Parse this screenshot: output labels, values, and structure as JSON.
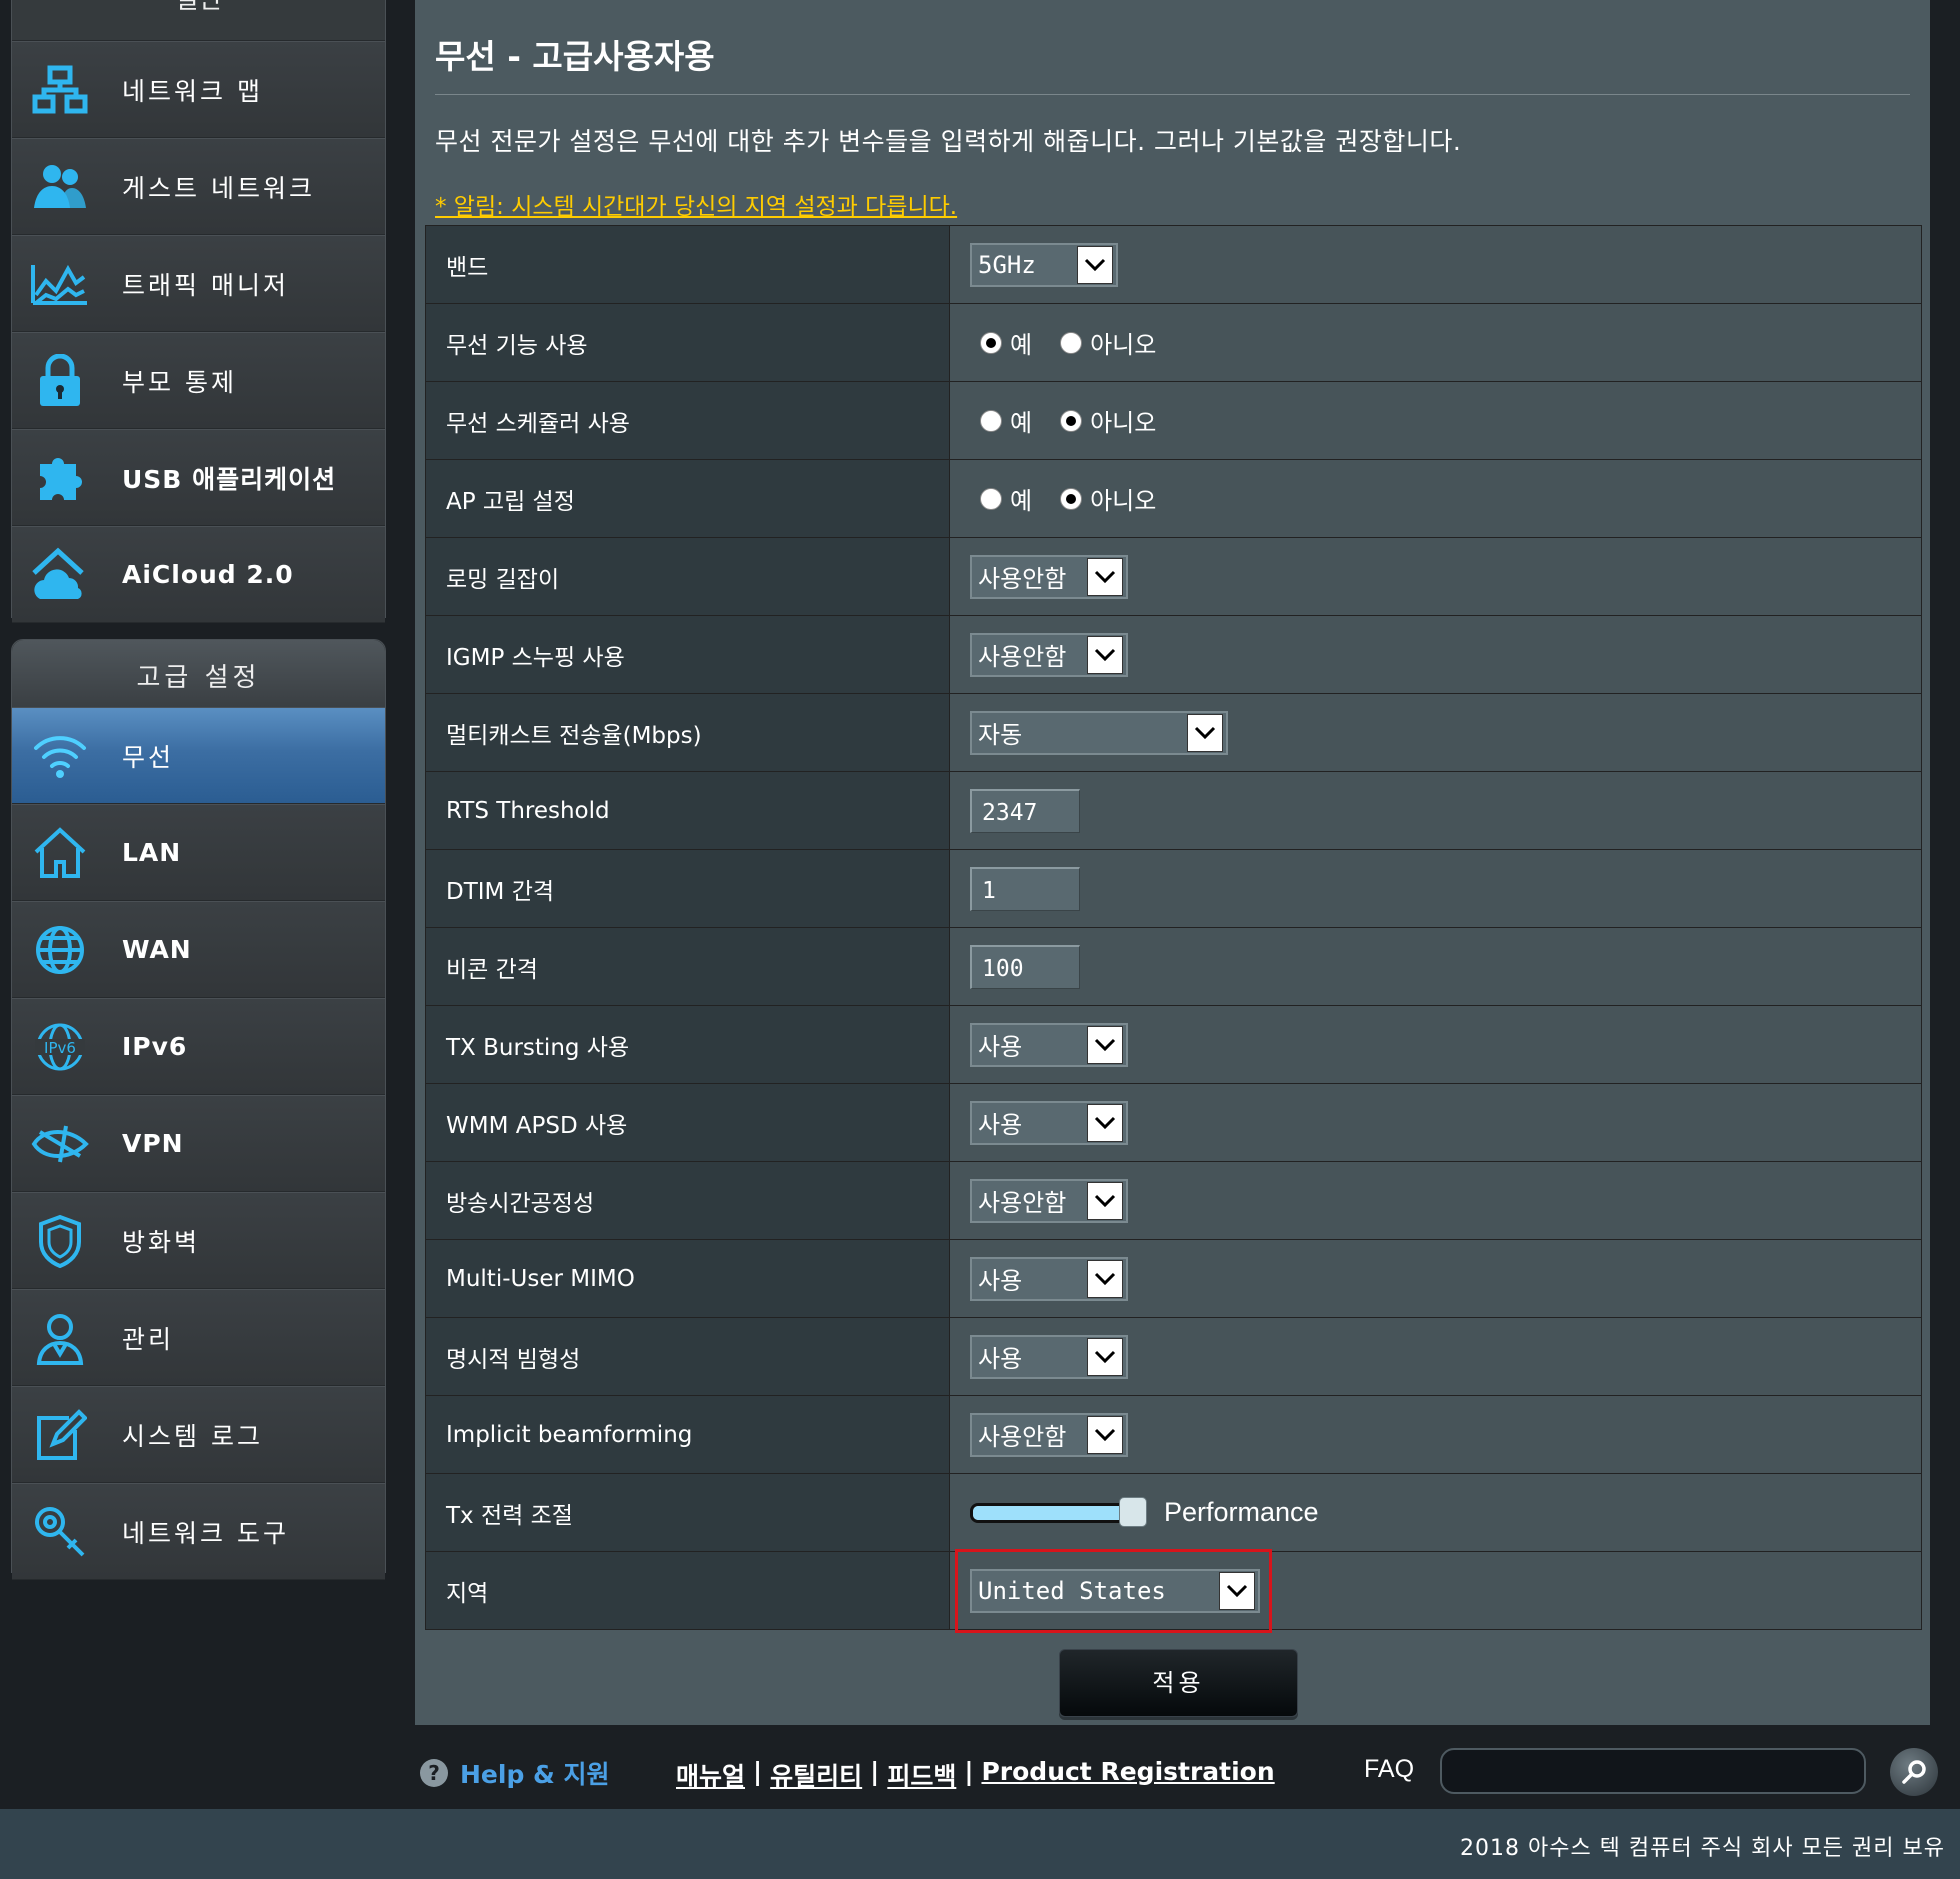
{
  "sidebar": {
    "general_header": "일반",
    "general_items": [
      {
        "label": "네트워크 맵",
        "icon": "network-map-icon"
      },
      {
        "label": "게스트 네트워크",
        "icon": "guest-network-icon"
      },
      {
        "label": "트래픽 매니저",
        "icon": "traffic-manager-icon"
      },
      {
        "label": "부모 통제",
        "icon": "parental-control-lock-icon"
      },
      {
        "label": "USB 애플리케이션",
        "icon": "usb-puzzle-icon"
      },
      {
        "label": "AiCloud 2.0",
        "icon": "aicloud-icon"
      }
    ],
    "advanced_header": "고급 설정",
    "advanced_items": [
      {
        "label": "무선",
        "icon": "wireless-icon",
        "active": true
      },
      {
        "label": "LAN",
        "icon": "home-icon"
      },
      {
        "label": "WAN",
        "icon": "globe-icon"
      },
      {
        "label": "IPv6",
        "icon": "ipv6-icon"
      },
      {
        "label": "VPN",
        "icon": "vpn-icon"
      },
      {
        "label": "방화벽",
        "icon": "firewall-shield-icon"
      },
      {
        "label": "관리",
        "icon": "admin-user-icon"
      },
      {
        "label": "시스템 로그",
        "icon": "system-log-icon"
      },
      {
        "label": "네트워크 도구",
        "icon": "network-tools-icon"
      }
    ]
  },
  "main": {
    "title": "무선 - 고급사용자용",
    "description": "무선 전문가 설정은 무선에 대한 추가 변수들을 입력하게 해줍니다. 그러나 기본값을 권장합니다.",
    "notice": "* 알림: 시스템 시간대가 당신의 지역 설정과 다릅니다.",
    "radio_yes": "예",
    "radio_no": "아니오",
    "rows": {
      "band": {
        "label": "밴드",
        "value": "5GHz"
      },
      "radio_enable": {
        "label": "무선 기능 사용",
        "selected": "yes"
      },
      "scheduler": {
        "label": "무선 스케쥴러 사용",
        "selected": "no"
      },
      "ap_isolate": {
        "label": "AP 고립 설정",
        "selected": "no"
      },
      "roaming": {
        "label": "로밍 길잡이",
        "value": "사용안함"
      },
      "igmp": {
        "label": "IGMP 스누핑 사용",
        "value": "사용안함"
      },
      "multicast": {
        "label": "멀티캐스트 전송율(Mbps)",
        "value": "자동"
      },
      "rts": {
        "label": "RTS Threshold",
        "value": "2347"
      },
      "dtim": {
        "label": "DTIM 간격",
        "value": "1"
      },
      "beacon": {
        "label": "비콘 간격",
        "value": "100"
      },
      "tx_bursting": {
        "label": "TX Bursting 사용",
        "value": "사용"
      },
      "wmm_apsd": {
        "label": "WMM APSD 사용",
        "value": "사용"
      },
      "airtime": {
        "label": "방송시간공정성",
        "value": "사용안함"
      },
      "mu_mimo": {
        "label": "Multi-User MIMO",
        "value": "사용"
      },
      "explicit_bf": {
        "label": "명시적 빔형성",
        "value": "사용"
      },
      "implicit_bf": {
        "label": "Implicit beamforming",
        "value": "사용안함"
      },
      "tx_power": {
        "label": "Tx 전력 조절",
        "value_text": "Performance",
        "level_percent": 100
      },
      "region": {
        "label": "지역",
        "value": "United States"
      }
    },
    "apply_label": "적용"
  },
  "footer": {
    "help_label": "Help & 지원",
    "links": [
      "매뉴얼",
      "유틸리티",
      "피드백",
      "Product Registration"
    ],
    "separator": "|",
    "faq_label": "FAQ",
    "copyright": "2018 아수스 텍 컴퓨터 주식 회사 모든 권리 보유"
  },
  "colors": {
    "accent_blue": "#3c6ea3",
    "notice_yellow": "#ffcc00",
    "highlight_red": "#d8141b",
    "help_blue": "#4ba0e6"
  }
}
